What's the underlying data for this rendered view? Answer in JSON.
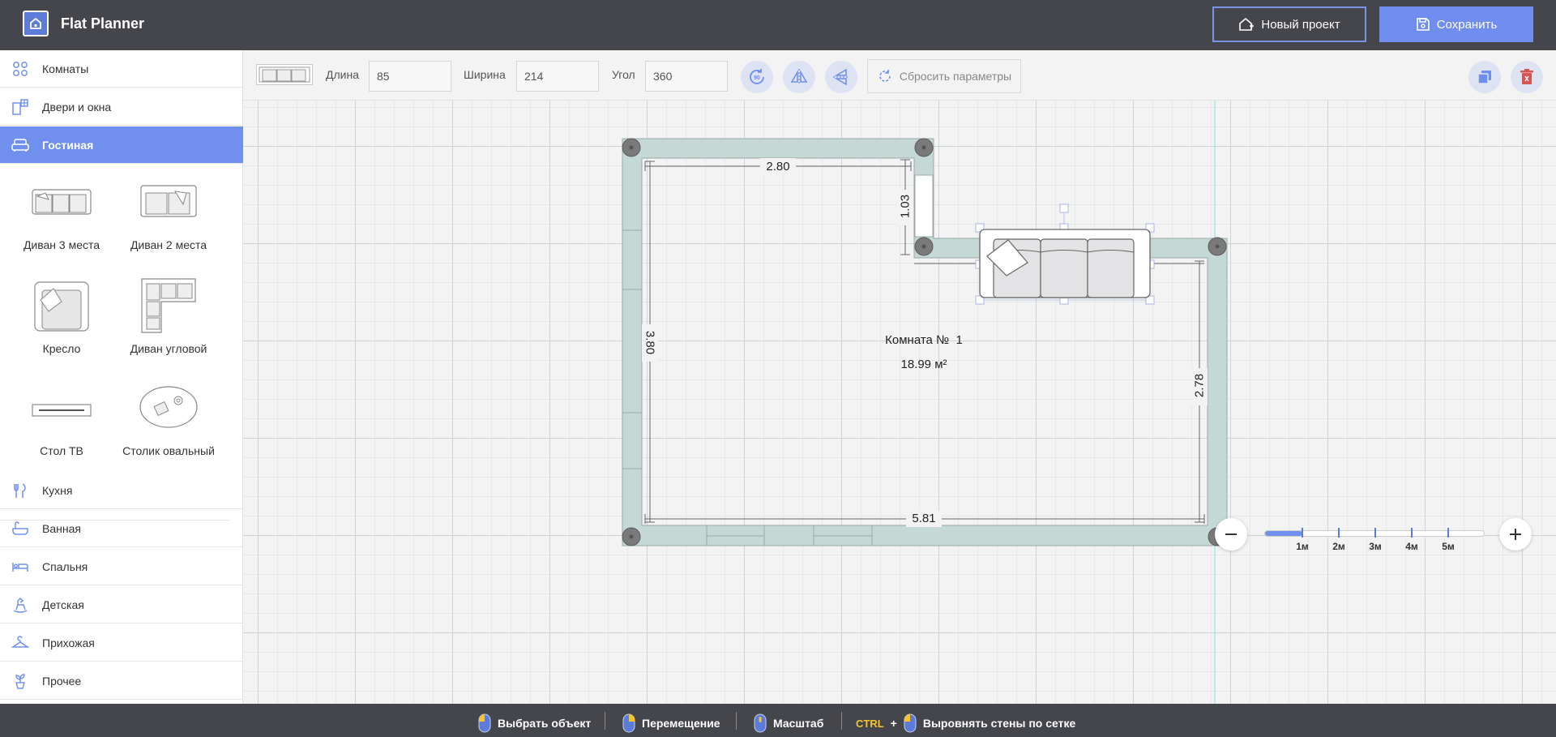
{
  "app": {
    "title": "Flat Planner"
  },
  "header": {
    "new_project": "Новый проект",
    "save": "Сохранить"
  },
  "sidebar": {
    "top_items": [
      {
        "label": "Комнаты",
        "icon": "rooms-icon"
      },
      {
        "label": "Двери и окна",
        "icon": "door-window-icon"
      },
      {
        "label": "Гостиная",
        "icon": "armchair-icon",
        "active": true
      }
    ],
    "catalog": [
      {
        "label": "Диван 3 места",
        "icon": "sofa-3-icon"
      },
      {
        "label": "Диван 2 места",
        "icon": "sofa-2-icon"
      },
      {
        "label": "Кресло",
        "icon": "armchair-item-icon"
      },
      {
        "label": "Диван угловой",
        "icon": "corner-sofa-icon"
      },
      {
        "label": "Стол ТВ",
        "icon": "tv-table-icon"
      },
      {
        "label": "Столик овальный",
        "icon": "oval-table-icon"
      }
    ],
    "bottom_items": [
      {
        "label": "Кухня",
        "icon": "fork-knife-icon"
      },
      {
        "label": "Ванная",
        "icon": "bathtub-icon"
      },
      {
        "label": "Спальня",
        "icon": "bed-icon"
      },
      {
        "label": "Детская",
        "icon": "rocking-horse-icon"
      },
      {
        "label": "Прихожая",
        "icon": "hanger-icon"
      },
      {
        "label": "Прочее",
        "icon": "plant-icon"
      }
    ]
  },
  "toolbar": {
    "length_label": "Длина",
    "length_value": "85",
    "width_label": "Ширина",
    "width_value": "214",
    "angle_label": "Угол",
    "angle_value": "360",
    "reset_label": "Сбросить параметры"
  },
  "plan": {
    "room_name": "Комната №  1",
    "room_area": "18.99 м²",
    "dim_top": "2.80",
    "dim_notch": "1.03",
    "dim_left": "3.80",
    "dim_right": "2.78",
    "dim_bottom": "5.81",
    "wall_color": "#c4d8d6",
    "accent_color": "#7190ee"
  },
  "zoom": {
    "ticks": [
      "1м",
      "2м",
      "3м",
      "4м",
      "5м"
    ],
    "level_fraction": 0.17
  },
  "footer": {
    "select": "Выбрать объект",
    "move": "Перемещение",
    "scale": "Масштаб",
    "ctrl": "CTRL",
    "plus": "+",
    "align": "Выровнять стены по сетке"
  }
}
